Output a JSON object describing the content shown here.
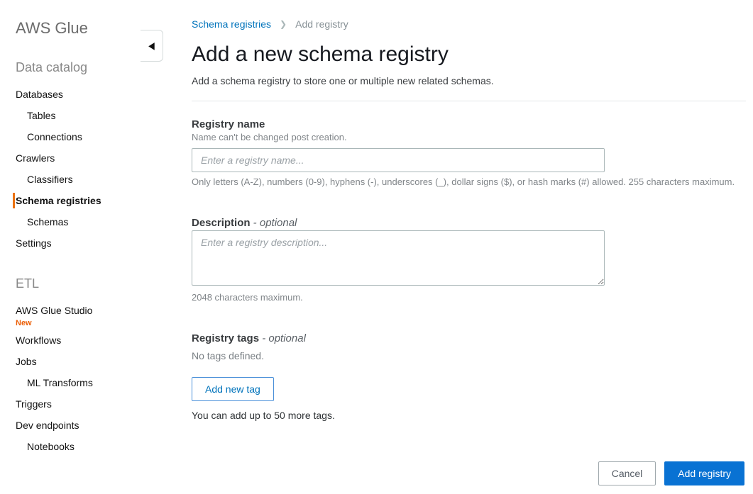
{
  "service_title": "AWS Glue",
  "sidebar": {
    "section1_title": "Data catalog",
    "section1_items": [
      {
        "label": "Databases",
        "sub": false
      },
      {
        "label": "Tables",
        "sub": true
      },
      {
        "label": "Connections",
        "sub": true
      },
      {
        "label": "Crawlers",
        "sub": false
      },
      {
        "label": "Classifiers",
        "sub": true
      },
      {
        "label": "Schema registries",
        "sub": false,
        "active": true
      },
      {
        "label": "Schemas",
        "sub": true
      },
      {
        "label": "Settings",
        "sub": false
      }
    ],
    "section2_title": "ETL",
    "section2_items": [
      {
        "label": "AWS Glue Studio",
        "sub": false,
        "badge": "New"
      },
      {
        "label": "Workflows",
        "sub": false
      },
      {
        "label": "Jobs",
        "sub": false
      },
      {
        "label": "ML Transforms",
        "sub": true
      },
      {
        "label": "Triggers",
        "sub": false
      },
      {
        "label": "Dev endpoints",
        "sub": false
      },
      {
        "label": "Notebooks",
        "sub": true
      }
    ]
  },
  "breadcrumb": {
    "parent": "Schema registries",
    "current": "Add registry"
  },
  "page": {
    "title": "Add a new schema registry",
    "subtitle": "Add a schema registry to store one or multiple new related schemas."
  },
  "form": {
    "name_label": "Registry name",
    "name_hint_top": "Name can't be changed post creation.",
    "name_placeholder": "Enter a registry name...",
    "name_hint_bottom": "Only letters (A-Z), numbers (0-9), hyphens (-), underscores (_), dollar signs ($), or hash marks (#) allowed. 255 characters maximum.",
    "desc_label": "Description",
    "desc_optional": " - optional",
    "desc_placeholder": "Enter a registry description...",
    "desc_hint_bottom": "2048 characters maximum.",
    "tags_label": "Registry tags",
    "tags_optional": " - optional",
    "tags_empty": "No tags defined.",
    "tags_add_btn": "Add new tag",
    "tags_help": "You can add up to 50 more tags."
  },
  "footer": {
    "cancel": "Cancel",
    "submit": "Add registry"
  }
}
